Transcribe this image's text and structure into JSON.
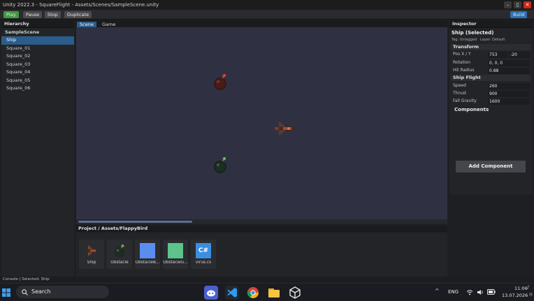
{
  "window": {
    "title": "Unity 2022.3  -  SquareFlight  -  Assets/Scenes/SampleScene.unity"
  },
  "toolbar": {
    "play_label": "Play",
    "pause_label": "Pause",
    "stop_label": "Stop",
    "duplicate_label": "Duplicate",
    "build_label": "Build"
  },
  "hierarchy": {
    "title": "Hierarchy",
    "scene_name": "SampleScene",
    "items": [
      {
        "label": "Ship",
        "selected": true
      },
      {
        "label": "Square_01"
      },
      {
        "label": "Square_02"
      },
      {
        "label": "Square_03"
      },
      {
        "label": "Square_04"
      },
      {
        "label": "Square_05"
      },
      {
        "label": "Square_06"
      }
    ]
  },
  "viewport": {
    "tabs": [
      "Scene",
      "Game"
    ],
    "active_tab": "Scene",
    "horizontal_scroll_fraction": 0.31
  },
  "inspector": {
    "title": "Inspector",
    "object_name": "Ship  (Selected)",
    "tag": "Tag: Untagged",
    "layer": "Layer: Default",
    "transform_header": "Transform",
    "pos_label": "Pos X / Y",
    "pos_x": "753",
    "pos_y": "-20",
    "rotation_label": "Rotation",
    "rotation_value": "0, 0, 0",
    "hit_radius_label": "Hit Radius",
    "hit_radius_value": "0.88",
    "ship_flight_header": "Ship Flight",
    "speed_label": "Speed",
    "speed_value": "260",
    "thrust_label": "Thrust",
    "thrust_value": "900",
    "fall_gravity_label": "Fall Gravity",
    "fall_gravity_value": "1600",
    "components_label": "Components",
    "add_component_label": "Add Component"
  },
  "project": {
    "breadcrumb": "Project  /  Assets/FlappyBird",
    "assets": [
      {
        "name": "Ship",
        "icon": "ship-sprite-icon"
      },
      {
        "name": "Obstacle",
        "icon": "bomb-sprite-icon"
      },
      {
        "name": "ObstacleB...",
        "icon": "blue-square-icon",
        "color": "#5b8def"
      },
      {
        "name": "ObstacleG...",
        "icon": "green-square-icon",
        "color": "#5cc38c"
      },
      {
        "name": "virus.cs",
        "icon": "csharp-script-icon",
        "glyph": "C#",
        "color": "#3b8ee0"
      }
    ]
  },
  "status": {
    "text": "Console  |  Selected: Ship"
  },
  "taskbar": {
    "search_label": "Search",
    "language": "ENG",
    "time": "11:06",
    "date": "13.07.2026"
  },
  "colors": {
    "accent": "#2c5d8a",
    "play_green": "#3f9a3f",
    "build_blue": "#2f6fb3",
    "close_red": "#c42b1c",
    "scene_bg": "#2f3143"
  }
}
